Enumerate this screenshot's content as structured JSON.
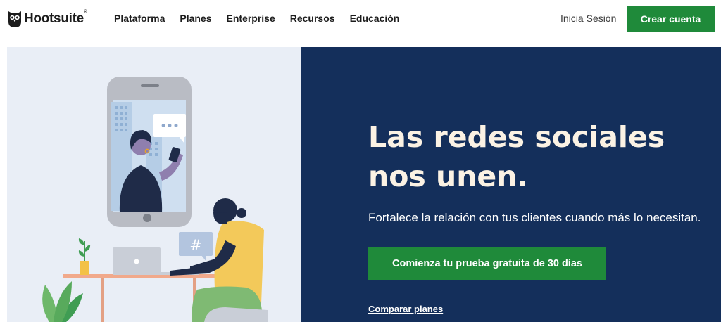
{
  "header": {
    "logo_text": "Hootsuite",
    "logo_reg": "®",
    "nav": [
      {
        "label": "Plataforma"
      },
      {
        "label": "Planes"
      },
      {
        "label": "Enterprise"
      },
      {
        "label": "Recursos"
      },
      {
        "label": "Educación"
      }
    ],
    "login_label": "Inicia Sesión",
    "cta_label": "Crear cuenta"
  },
  "hero": {
    "title": "Las redes sociales nos unen.",
    "subtitle": "Fortalece la relación con tus clientes cuando más lo necesitan.",
    "cta_label": "Comienza tu prueba gratuita de 30 días",
    "link_label": "Comparar planes"
  },
  "illustration": {
    "chat_dots": "•••",
    "hashtag": "#"
  },
  "colors": {
    "brand_green": "#1f8a3a",
    "hero_navy": "#142f5b",
    "hero_title": "#fbf2e4",
    "illustration_bg": "#e9eef6"
  }
}
